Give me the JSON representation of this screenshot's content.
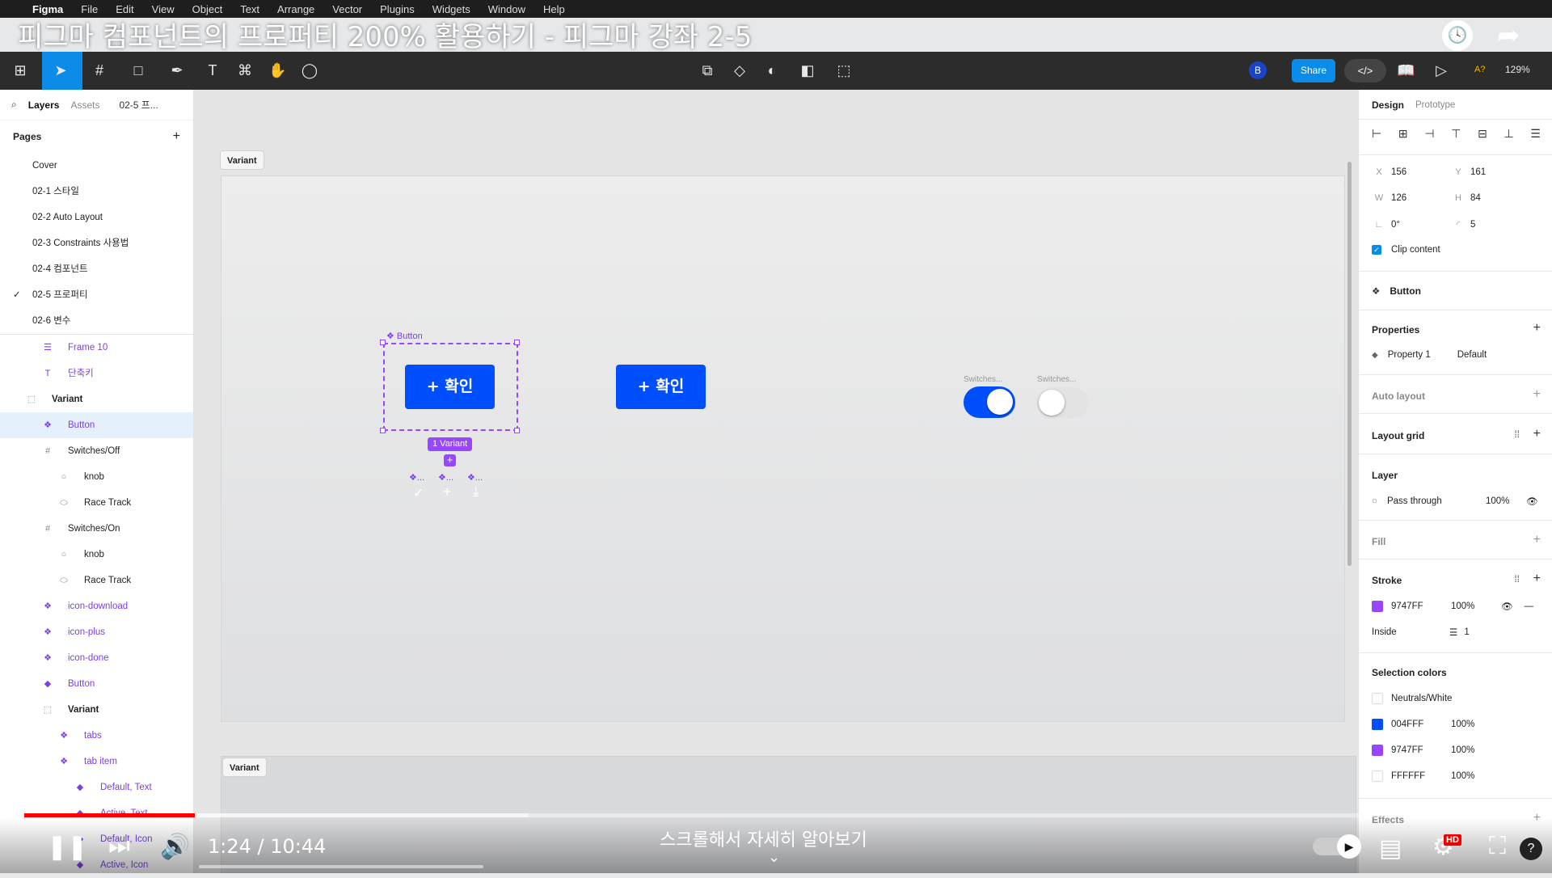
{
  "video": {
    "title": "피그마 컴포넌트의 프로퍼티 200% 활용하기 - 피그마 강좌 2-5",
    "time": "1:24 / 10:44",
    "scroll_hint": "스크롤해서 자세히 알아보기",
    "progress": 0.113,
    "quality_badge": "HD"
  },
  "menubar": {
    "app": "Figma",
    "items": [
      "File",
      "Edit",
      "View",
      "Object",
      "Text",
      "Arrange",
      "Vector",
      "Plugins",
      "Widgets",
      "Window",
      "Help"
    ]
  },
  "toolbar": {
    "share_label": "Share",
    "avatar_initial": "B",
    "zoom": "129%",
    "ai_label": "A?"
  },
  "left_panel": {
    "tabs": [
      "Layers",
      "Assets",
      "02-5 프..."
    ],
    "pages_title": "Pages",
    "pages": [
      {
        "name": "Cover",
        "current": false
      },
      {
        "name": "02-1 스타일",
        "current": false
      },
      {
        "name": "02-2 Auto Layout",
        "current": false
      },
      {
        "name": "02-3 Constraints 사용법",
        "current": false
      },
      {
        "name": "02-4 컴포넌트",
        "current": false
      },
      {
        "name": "02-5 프로퍼티",
        "current": true
      },
      {
        "name": "02-6 변수",
        "current": false
      }
    ],
    "layers": [
      {
        "name": "Frame 10",
        "icon": "hash-lines-icon",
        "level": 1,
        "purple": true,
        "selected": false
      },
      {
        "name": "단축키",
        "icon": "text-icon",
        "level": 1,
        "purple": true,
        "selected": false
      },
      {
        "name": "Variant",
        "icon": "frame-icon",
        "level": 0,
        "purple": false,
        "selected": false,
        "bold": true
      },
      {
        "name": "Button",
        "icon": "component-icon",
        "level": 1,
        "purple": true,
        "selected": true
      },
      {
        "name": "Switches/Off",
        "icon": "hash-icon",
        "level": 1,
        "purple": false,
        "selected": false
      },
      {
        "name": "knob",
        "icon": "circle-icon",
        "level": 2,
        "purple": false,
        "selected": false
      },
      {
        "name": "Race Track",
        "icon": "pill-icon",
        "level": 2,
        "purple": false,
        "selected": false
      },
      {
        "name": "Switches/On",
        "icon": "hash-icon",
        "level": 1,
        "purple": false,
        "selected": false
      },
      {
        "name": "knob",
        "icon": "circle-icon",
        "level": 2,
        "purple": false,
        "selected": false
      },
      {
        "name": "Race Track",
        "icon": "pill-icon",
        "level": 2,
        "purple": false,
        "selected": false
      },
      {
        "name": "icon-download",
        "icon": "component-icon",
        "level": 1,
        "purple": true,
        "selected": false
      },
      {
        "name": "icon-plus",
        "icon": "component-icon",
        "level": 1,
        "purple": true,
        "selected": false
      },
      {
        "name": "icon-done",
        "icon": "component-icon",
        "level": 1,
        "purple": true,
        "selected": false
      },
      {
        "name": "Button",
        "icon": "diamond-icon",
        "level": 1,
        "purple": true,
        "selected": false
      },
      {
        "name": "Variant",
        "icon": "frame-icon",
        "level": 1,
        "purple": false,
        "selected": false,
        "bold": true
      },
      {
        "name": "tabs",
        "icon": "component-icon",
        "level": 2,
        "purple": true,
        "selected": false
      },
      {
        "name": "tab item",
        "icon": "component-icon",
        "level": 2,
        "purple": true,
        "selected": false
      },
      {
        "name": "Default, Text",
        "icon": "diamond-icon",
        "level": 3,
        "purple": true,
        "selected": false
      },
      {
        "name": "Active, Text",
        "icon": "diamond-icon",
        "level": 3,
        "purple": true,
        "selected": false
      },
      {
        "name": "Default, Icon",
        "icon": "diamond-icon",
        "level": 3,
        "purple": true,
        "selected": false
      },
      {
        "name": "Active, Icon",
        "icon": "diamond-icon",
        "level": 3,
        "purple": true,
        "selected": false
      }
    ]
  },
  "canvas": {
    "frame1_label": "Variant",
    "frame2_label": "Variant",
    "component_label": "Button",
    "button_text": "+ 확인",
    "variant_badge": "1 Variant",
    "variant_minis": [
      "❖...",
      "❖...",
      "❖..."
    ],
    "switch_label_on": "Switches...",
    "switch_label_off": "Switches..."
  },
  "right_panel": {
    "tabs": [
      "Design",
      "Prototype"
    ],
    "x_label": "X",
    "x": "156",
    "y_label": "Y",
    "y": "161",
    "w_label": "W",
    "w": "126",
    "h_label": "H",
    "h": "84",
    "rotation": "0°",
    "radius": "5",
    "clip_content": "Clip content",
    "component_name": "Button",
    "properties_title": "Properties",
    "property_name": "Property 1",
    "property_value": "Default",
    "auto_layout": "Auto layout",
    "layout_grid": "Layout grid",
    "layer_title": "Layer",
    "blend": "Pass through",
    "opacity": "100%",
    "fill_title": "Fill",
    "stroke_title": "Stroke",
    "stroke_color": "9747FF",
    "stroke_opacity": "100%",
    "stroke_pos": "Inside",
    "stroke_width": "1",
    "selection_colors_title": "Selection colors",
    "selection_colors": [
      {
        "name": "Neutrals/White",
        "opacity": "",
        "hex": "#ffffff"
      },
      {
        "name": "004FFF",
        "opacity": "100%",
        "hex": "#004fff"
      },
      {
        "name": "9747FF",
        "opacity": "100%",
        "hex": "#9747ff"
      },
      {
        "name": "FFFFFF",
        "opacity": "100%",
        "hex": "#ffffff"
      }
    ],
    "effects_title": "Effects"
  },
  "colors": {
    "accent": "#0c8ce9",
    "primary_button": "#004fff",
    "component_purple": "#9747ff",
    "progress": "#ff0000"
  }
}
